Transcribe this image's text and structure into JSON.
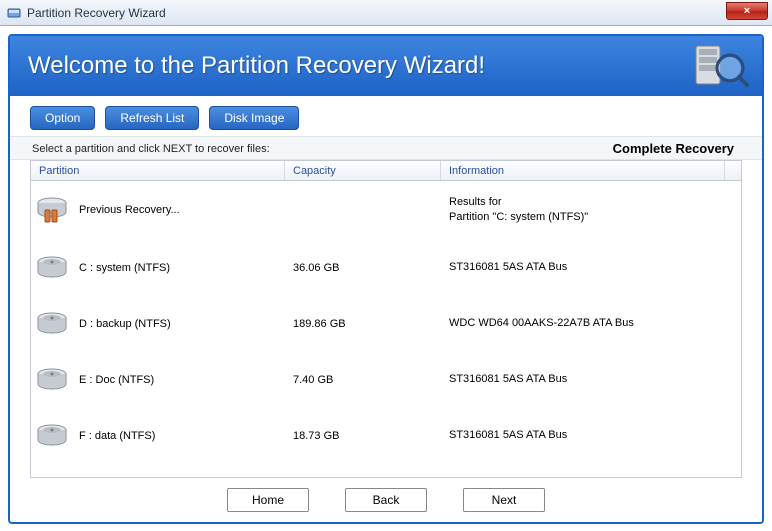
{
  "window": {
    "title": "Partition Recovery Wizard",
    "close_label": "×"
  },
  "header": {
    "title": "Welcome to the Partition Recovery Wizard!"
  },
  "toolbar": {
    "option": "Option",
    "refresh": "Refresh List",
    "disk_image": "Disk Image"
  },
  "instruction": "Select a partition and click NEXT to recover files:",
  "mode_label": "Complete Recovery",
  "columns": {
    "partition": "Partition",
    "capacity": "Capacity",
    "information": "Information"
  },
  "rows": [
    {
      "icon": "prev",
      "partition": "Previous Recovery...",
      "capacity": "",
      "info_line1": "Results for",
      "info_line2": "Partition \"C: system (NTFS)\""
    },
    {
      "icon": "drive",
      "partition": "C : system  (NTFS)",
      "capacity": "36.06 GB",
      "info_line1": "ST316081  5AS   ATA Bus",
      "info_line2": ""
    },
    {
      "icon": "drive",
      "partition": "D : backup  (NTFS)",
      "capacity": "189.86 GB",
      "info_line1": "WDC WD64  00AAKS-22A7B   ATA Bus",
      "info_line2": ""
    },
    {
      "icon": "drive",
      "partition": "E : Doc  (NTFS)",
      "capacity": "7.40 GB",
      "info_line1": "ST316081  5AS   ATA Bus",
      "info_line2": ""
    },
    {
      "icon": "drive",
      "partition": "F : data  (NTFS)",
      "capacity": "18.73 GB",
      "info_line1": "ST316081  5AS   ATA Bus",
      "info_line2": ""
    }
  ],
  "buttons": {
    "home": "Home",
    "back": "Back",
    "next": "Next"
  }
}
